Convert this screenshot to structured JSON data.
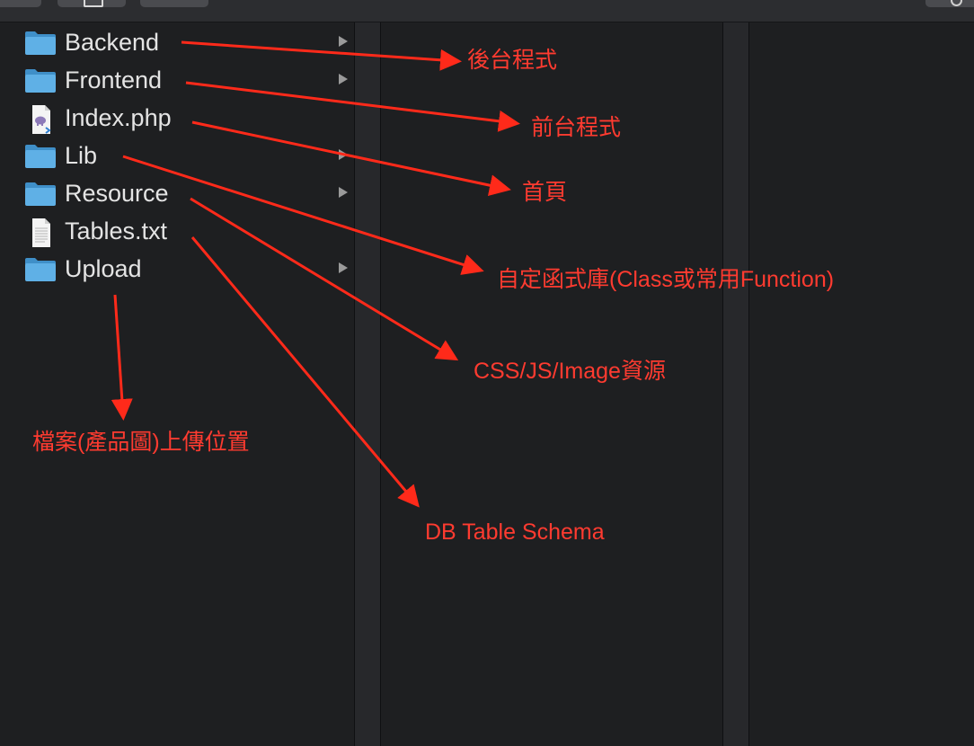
{
  "files": [
    {
      "label": "Backend",
      "icon": "folder-icon",
      "has_children": true
    },
    {
      "label": "Frontend",
      "icon": "folder-icon",
      "has_children": true
    },
    {
      "label": "Index.php",
      "icon": "php-file-icon",
      "has_children": false
    },
    {
      "label": "Lib",
      "icon": "folder-icon",
      "has_children": true
    },
    {
      "label": "Resource",
      "icon": "folder-icon",
      "has_children": true
    },
    {
      "label": "Tables.txt",
      "icon": "text-file-icon",
      "has_children": false
    },
    {
      "label": "Upload",
      "icon": "folder-icon",
      "has_children": true
    }
  ],
  "annotations": [
    {
      "text": "後台程式"
    },
    {
      "text": "前台程式"
    },
    {
      "text": "首頁"
    },
    {
      "text": "自定函式庫(Class或常用Function)"
    },
    {
      "text": "CSS/JS/Image資源"
    },
    {
      "text": "DB Table Schema"
    },
    {
      "text": "檔案(產品圖)上傳位置"
    }
  ],
  "colors": {
    "background": "#1e1f21",
    "folder": "#5fb0e6",
    "annotation": "#ff3b30",
    "text": "#e4e4e4"
  }
}
